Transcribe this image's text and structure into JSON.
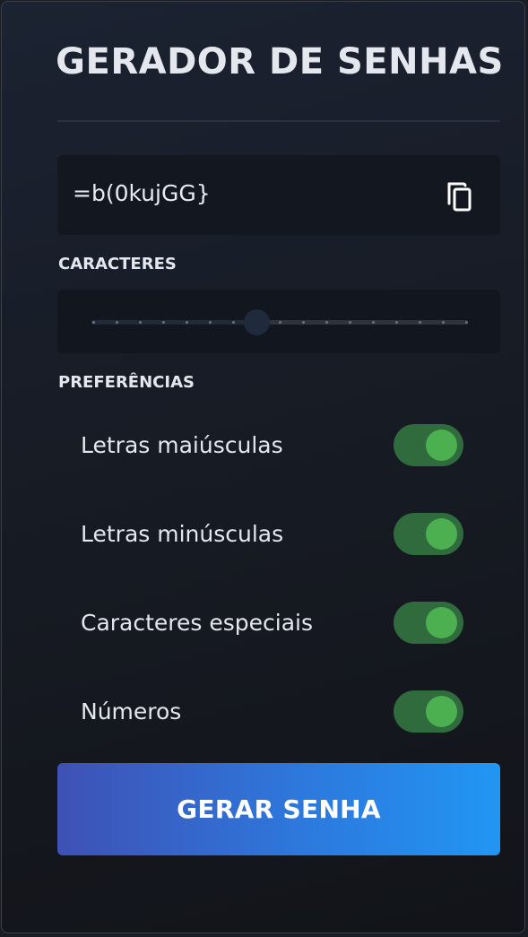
{
  "app": {
    "title": "GERADOR DE SENHAS"
  },
  "password": {
    "value": "=b(0kujGG}",
    "copy_icon": "copy-icon"
  },
  "characters": {
    "label": "CARACTERES",
    "slider_steps": 17,
    "slider_fraction": 0.438
  },
  "preferences": {
    "label": "PREFERÊNCIAS",
    "items": [
      {
        "label": "Letras maiúsculas",
        "enabled": true
      },
      {
        "label": "Letras minúsculas",
        "enabled": true
      },
      {
        "label": "Caracteres especiais",
        "enabled": true
      },
      {
        "label": "Números",
        "enabled": true
      }
    ]
  },
  "actions": {
    "generate_label": "GERAR SENHA"
  },
  "colors": {
    "toggle_on_track": "#2f6b3d",
    "toggle_on_knob": "#4caf50",
    "button_gradient_start": "#3f51b5",
    "button_gradient_end": "#2196f3"
  }
}
